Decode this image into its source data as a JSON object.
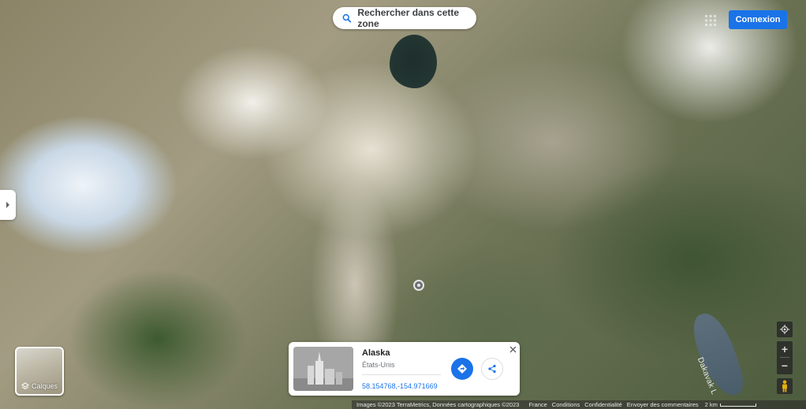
{
  "search": {
    "label": "Rechercher dans cette zone",
    "icon": "search-icon"
  },
  "header": {
    "login_label": "Connexion",
    "apps_icon": "apps-grid-icon"
  },
  "layers": {
    "label": "Calques",
    "icon": "layers-icon"
  },
  "map": {
    "river_label": "Dakavak L"
  },
  "place_card": {
    "title": "Alaska",
    "subtitle": "États-Unis",
    "coordinates": "58.154768,-154.971669",
    "directions_icon": "directions-icon",
    "share_icon": "share-icon",
    "close_icon": "close-icon"
  },
  "controls": {
    "zoom_in": "+",
    "zoom_out": "−",
    "locate_icon": "my-location-icon",
    "pegman_icon": "pegman-icon"
  },
  "footer": {
    "attribution": "Images ©2023 TerraMetrics, Données cartographiques ©2023",
    "country": "France",
    "terms": "Conditions",
    "privacy": "Confidentialité",
    "feedback": "Envoyer des commentaires",
    "scale": "2 km"
  },
  "colors": {
    "accent": "#1a73e8",
    "control_bg": "#2b2b2b"
  }
}
